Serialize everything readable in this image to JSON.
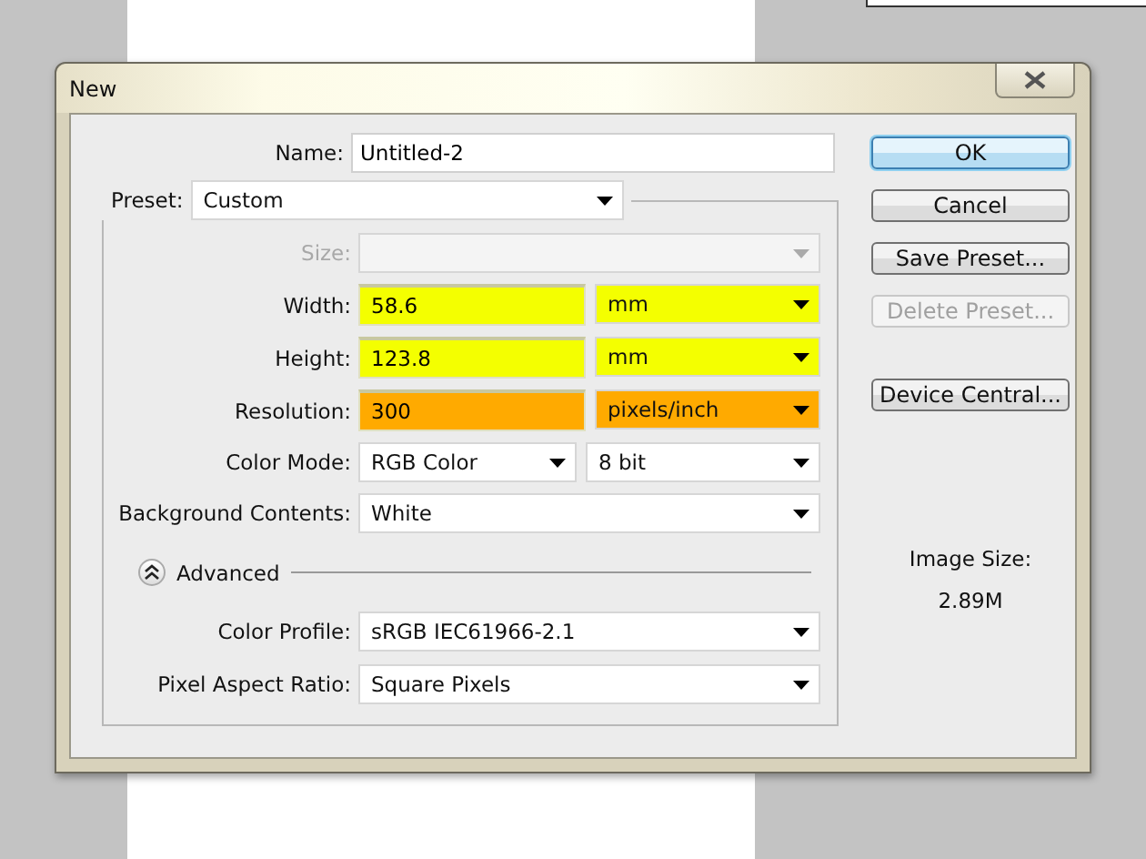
{
  "window": {
    "title": "New"
  },
  "name": {
    "label": "Name:",
    "value": "Untitled-2"
  },
  "preset": {
    "label": "Preset:",
    "value": "Custom"
  },
  "rows": [
    {
      "kind": "dropdown",
      "label": "Size:",
      "disabled": true
    },
    {
      "kind": "field_unit",
      "label": "Width:",
      "value": "58.6",
      "unit": "mm",
      "color": "#f4ff00",
      "disabled": false
    },
    {
      "kind": "field_unit",
      "label": "Height:",
      "value": "123.8",
      "unit": "mm",
      "color": "#f4ff00",
      "disabled": false
    },
    {
      "kind": "field_unit",
      "label": "Resolution:",
      "value": "300",
      "unit": "pixels/inch",
      "color": "#ffaa00",
      "disabled": false
    },
    {
      "kind": "dropdown_pair",
      "label": "Color Mode:",
      "value": "RGB Color",
      "value_2": "8 bit",
      "disabled": false
    },
    {
      "kind": "dropdown",
      "label": "Background Contents:",
      "value": "White",
      "disabled": false
    }
  ],
  "advanced": {
    "label": "Advanced",
    "expanded": true,
    "rows": [
      {
        "label": "Color Profile:",
        "value": "sRGB IEC61966-2.1"
      },
      {
        "label": "Pixel Aspect Ratio:",
        "value": "Square Pixels"
      }
    ]
  },
  "buttons": [
    {
      "label": "OK",
      "default": true,
      "disabled": false
    },
    {
      "label": "Cancel",
      "default": false,
      "disabled": false
    },
    {
      "label": "Save Preset...",
      "default": false,
      "disabled": false
    },
    {
      "label": "Delete Preset...",
      "default": false,
      "disabled": true
    },
    {
      "label": "Device Central...",
      "default": false,
      "disabled": false
    }
  ],
  "image_size": {
    "label": "Image Size:",
    "value": "2.89M"
  }
}
